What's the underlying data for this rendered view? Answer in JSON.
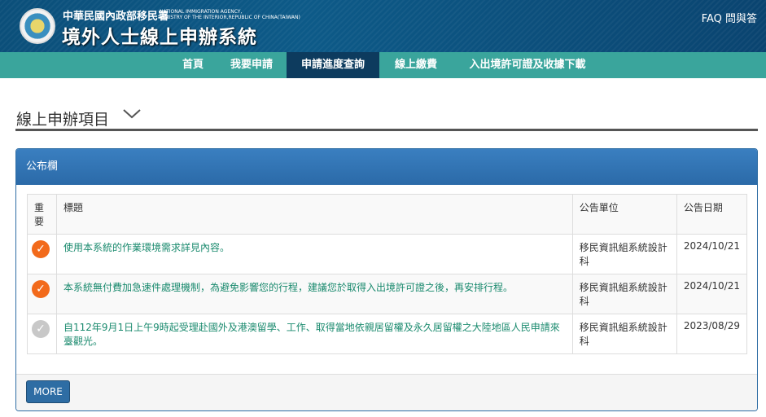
{
  "header": {
    "agency": "中華民國內政部移民署",
    "agency_en_1": "NATIONAL IMMIGRATION AGENCY,",
    "agency_en_2": "MINISTRY OF THE INTERIOR,REPUBLIC OF CHINA(TAIWAN)",
    "system_name": "境外人士線上申辦系統",
    "faq": "FAQ 問與答"
  },
  "nav": [
    "首頁",
    "我要申請",
    "申請進度查詢",
    "線上繳費",
    "入出境許可證及收據下載"
  ],
  "section_title": "線上申辦項目",
  "panel": {
    "title": "公布欄",
    "more": "MORE",
    "columns": [
      "重要",
      "標題",
      "公告單位",
      "公告日期"
    ],
    "rows": [
      {
        "important": true,
        "title": "使用本系統的作業環境需求詳見內容。",
        "unit": "移民資訊組系統設計科",
        "date": "2024/10/21"
      },
      {
        "important": true,
        "title": "本系統無付費加急速件處理機制，為避免影響您的行程，建議您於取得入出境許可證之後，再安排行程。",
        "unit": "移民資訊組系統設計科",
        "date": "2024/10/21"
      },
      {
        "important": false,
        "title": "自112年9月1日上午9時起受理赴國外及港澳留學、工作、取得當地依親居留權及永久居留權之大陸地區人民申請來臺觀光。",
        "unit": "移民資訊組系統設計科",
        "date": "2023/08/29"
      }
    ]
  },
  "colors": {
    "important": "#f26a1b",
    "normal": "#c8c8c8"
  }
}
